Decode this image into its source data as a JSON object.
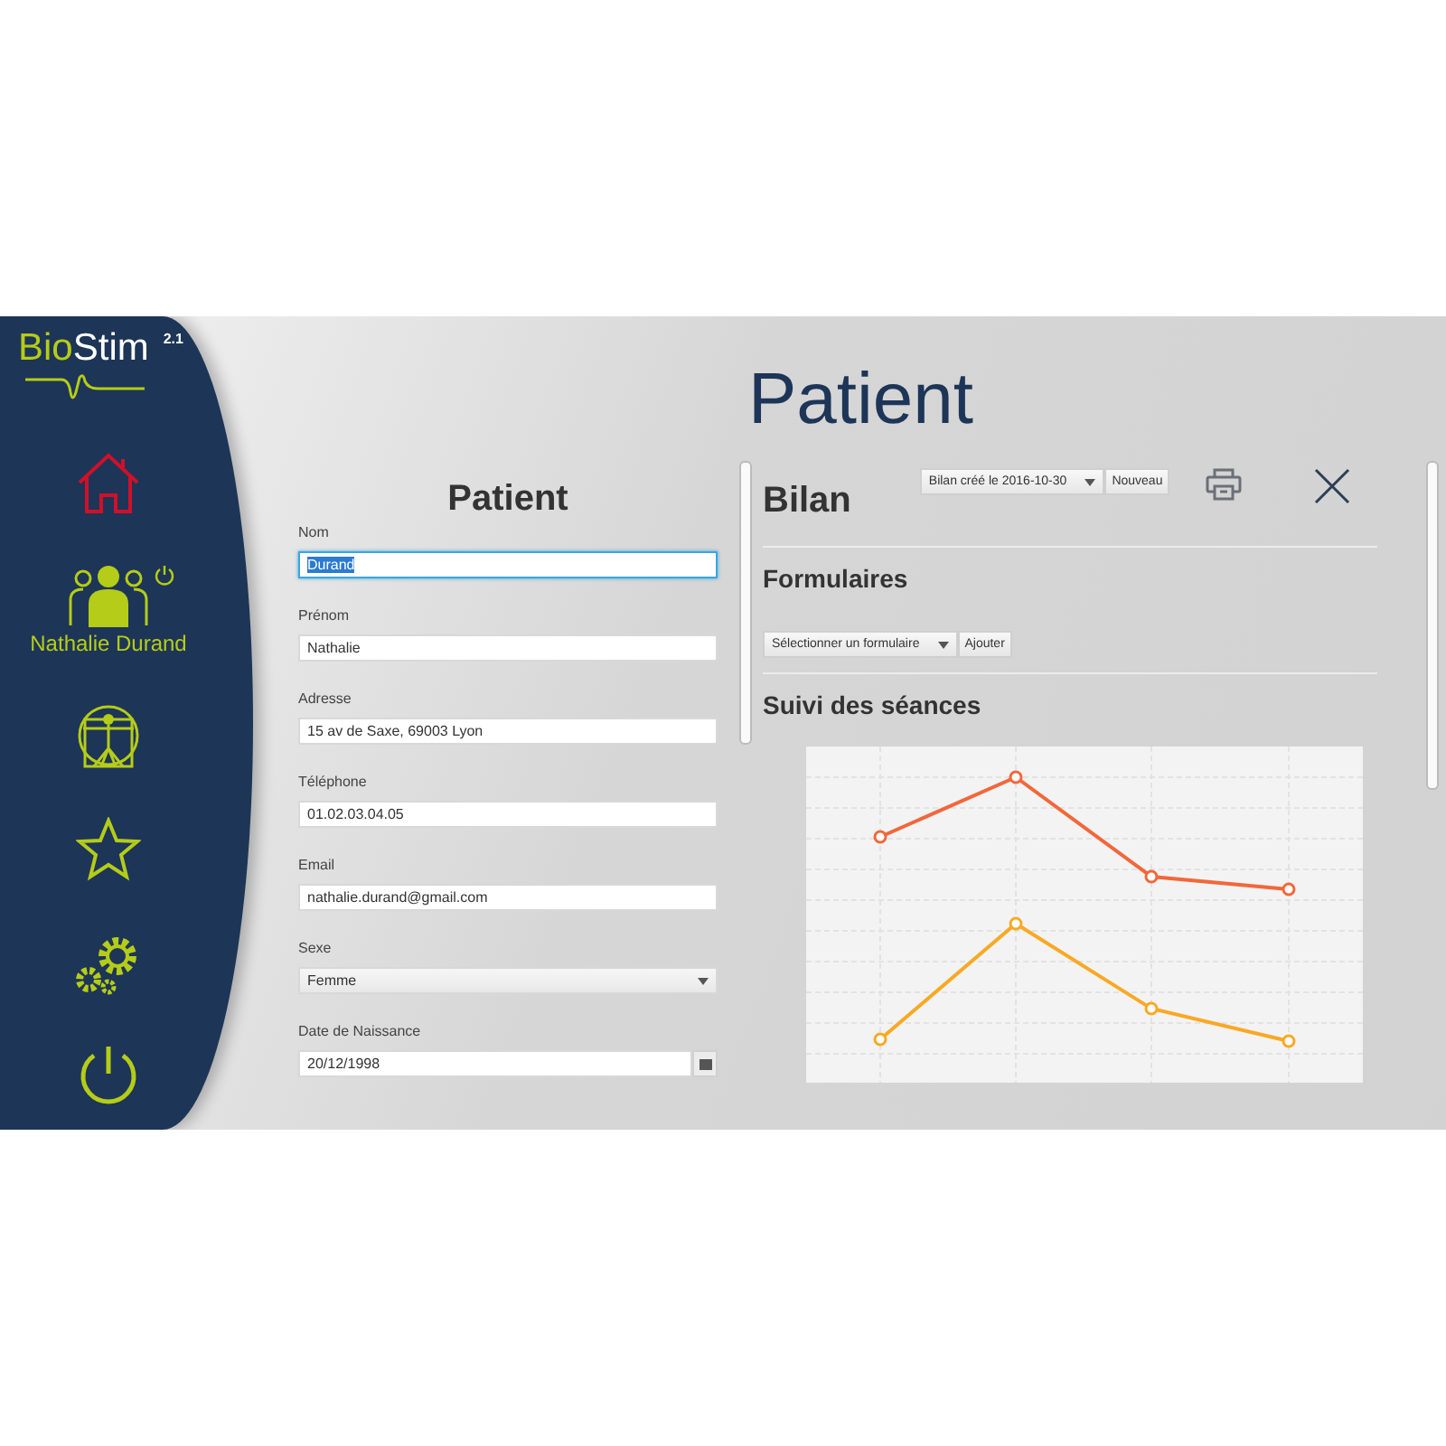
{
  "sidebar": {
    "logo": {
      "part_1": "Bio",
      "part_2": "Stim",
      "version": "2.1"
    },
    "items": [
      {
        "kind": "home",
        "selected": true
      },
      {
        "kind": "user",
        "selected": false,
        "label": "Nathalie Durand"
      },
      {
        "kind": "body",
        "selected": false
      },
      {
        "kind": "favorites",
        "selected": false
      },
      {
        "kind": "settings",
        "selected": false
      },
      {
        "kind": "power",
        "selected": false
      }
    ]
  },
  "page_title": "Patient",
  "patient_form": {
    "title": "Patient",
    "fields": [
      {
        "label": "Nom",
        "value": "Durand",
        "kind": "text",
        "focused": true
      },
      {
        "label": "Prénom",
        "value": "Nathalie",
        "kind": "text",
        "focused": false
      },
      {
        "label": "Adresse",
        "value": "15 av de Saxe, 69003 Lyon",
        "kind": "text",
        "focused": false
      },
      {
        "label": "Téléphone",
        "value": "01.02.03.04.05",
        "kind": "text",
        "focused": false
      },
      {
        "label": "Email",
        "value": "nathalie.durand@gmail.com",
        "kind": "text",
        "focused": false
      },
      {
        "label": "Sexe",
        "value": "Femme",
        "kind": "select",
        "focused": false
      },
      {
        "label": "Date de Naissance",
        "value": "20/12/1998",
        "kind": "date",
        "focused": false
      }
    ]
  },
  "bilan": {
    "title": "Bilan",
    "select": "Bilan créé le 2016-10-30",
    "button": "Nouveau"
  },
  "formulaires": {
    "title": "Formulaires",
    "select": "Sélectionner un formulaire",
    "button": "Ajouter"
  },
  "suivi": {
    "title": "Suivi des séances"
  }
}
